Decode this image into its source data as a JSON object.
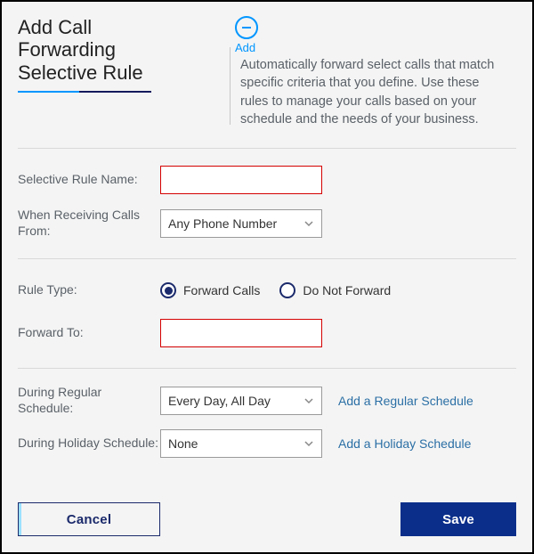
{
  "header": {
    "title": "Add Call Forwarding Selective Rule",
    "help_toggle_label": "Add",
    "help_text": "Automatically forward select calls that match specific criteria that you define. Use these rules to manage your calls based on your schedule and the needs of your business."
  },
  "fields": {
    "rule_name": {
      "label": "Selective Rule Name:",
      "value": ""
    },
    "when_from": {
      "label": "When Receiving Calls From:",
      "selected": "Any Phone Number"
    },
    "rule_type": {
      "label": "Rule Type:",
      "options": {
        "forward": "Forward Calls",
        "do_not_forward": "Do Not Forward"
      },
      "selected": "forward"
    },
    "forward_to": {
      "label": "Forward To:",
      "value": ""
    },
    "regular_sched": {
      "label": "During Regular Schedule:",
      "selected": "Every Day, All Day",
      "add_link": "Add a Regular Schedule"
    },
    "holiday_sched": {
      "label": "During Holiday Schedule:",
      "selected": "None",
      "add_link": "Add a Holiday Schedule"
    }
  },
  "buttons": {
    "cancel": "Cancel",
    "save": "Save"
  },
  "colors": {
    "accent_blue": "#0096ff",
    "brand_navy": "#0a2e8a",
    "error": "#d40000"
  }
}
